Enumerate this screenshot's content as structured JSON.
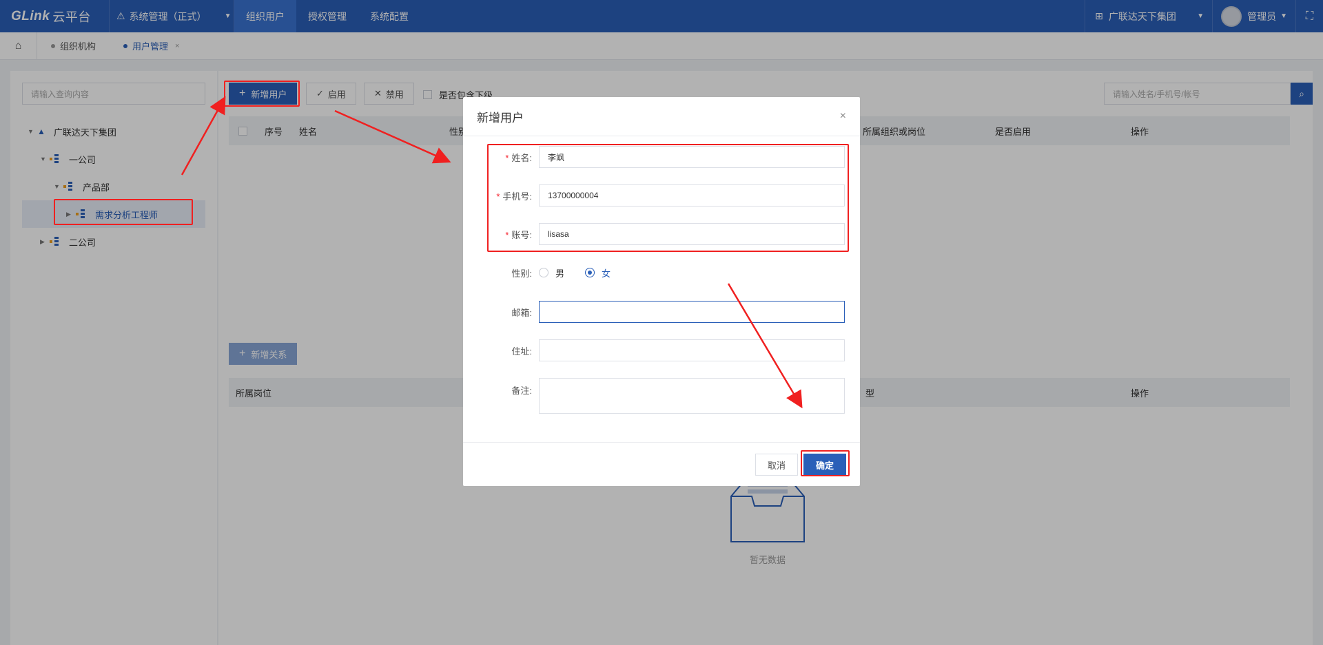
{
  "topbar": {
    "logo": "GLink",
    "logo_cn": "云平台",
    "system_menu": "系统管理（正式）",
    "nav_tabs": [
      "组织用户",
      "授权管理",
      "系统配置"
    ],
    "org_selector": "广联达天下集团",
    "user_name": "管理员"
  },
  "tabs": {
    "items": [
      "组织机构",
      "用户管理"
    ],
    "close": "×"
  },
  "left": {
    "search_placeholder": "请输入查询内容",
    "tree": [
      {
        "label": "广联达天下集团",
        "level": 0
      },
      {
        "label": "一公司",
        "level": 1
      },
      {
        "label": "产品部",
        "level": 2
      },
      {
        "label": "需求分析工程师",
        "level": 3,
        "selected": true
      },
      {
        "label": "二公司",
        "level": 1
      }
    ]
  },
  "toolbar": {
    "add_user": "新增用户",
    "enable": "启用",
    "disable": "禁用",
    "include_sub": "是否包含下级",
    "search_placeholder": "请输入姓名/手机号/帐号"
  },
  "user_table": {
    "columns": [
      "序号",
      "姓名",
      "性别",
      "所属组织或岗位",
      "是否启用",
      "操作"
    ]
  },
  "relation": {
    "add_relation": "新增关系",
    "columns": [
      "所属岗位",
      "型",
      "操作"
    ],
    "empty_text": "暂无数据"
  },
  "dialog": {
    "title": "新增用户",
    "close": "×",
    "fields": {
      "name_label": "姓名:",
      "name_value": "李飒",
      "phone_label": "手机号:",
      "phone_value": "13700000004",
      "account_label": "账号:",
      "account_value": "lisasa",
      "gender_label": "性别:",
      "gender_options": [
        "男",
        "女"
      ],
      "gender_selected": "女",
      "email_label": "邮箱:",
      "address_label": "住址:",
      "remark_label": "备注:"
    },
    "cancel": "取消",
    "confirm": "确定"
  },
  "colors": {
    "brand": "#2a5fb8",
    "annotation": "#f02020"
  }
}
